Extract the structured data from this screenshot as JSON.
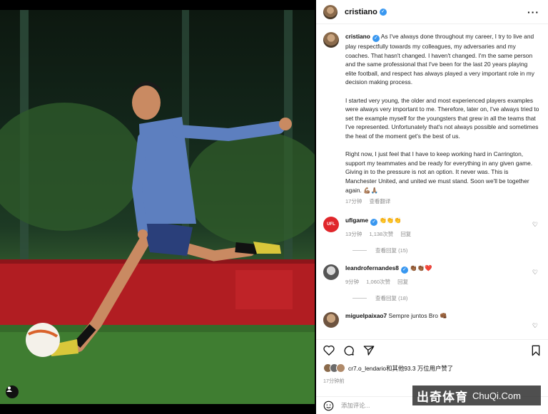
{
  "post": {
    "username": "cristiano",
    "caption": {
      "username": "cristiano",
      "p1": "As I've always done throughout my career, I try to live and play respectfully towards my colleagues, my adversaries and my coaches. That hasn't changed. I haven't changed. I'm the same person and the same professional that I've been for the last 20 years playing elite football, and respect has always played a very important role in my decision making process.",
      "p2": "I started very young, the older and most experienced players examples were always very important to me. Therefore, later on, I've always tried to set the example myself for the youngsters that grew in all the teams that I've represented. Unfortunately that's not always possible and sometimes the heat of the moment get's the best of us.",
      "p3": "Right now, I just feel that I have to keep working hard in Carrington, support my teammates and be ready for everything in any given game. Giving in to the pressure is not an option. It never was. This is Manchester United, and united we must stand. Soon we'll be together again. 💪🏽🙏🏽",
      "time": "17分钟",
      "translate": "查看翻译"
    },
    "comments": [
      {
        "username": "uflgame",
        "text": "👏👏👏",
        "time": "13分钟",
        "likes": "1,138次赞",
        "reply": "回复",
        "replies": "查看回复 (15)",
        "avatar_color": "#e0262b"
      },
      {
        "username": "leandrofernandes8",
        "text": "👏🏾👏🏾❤️",
        "time": "9分钟",
        "likes": "1,060次赞",
        "reply": "回复",
        "replies": "查看回复 (18)",
        "avatar_color": "#6b6b6b"
      },
      {
        "username": "miguelpaixao7",
        "text": "Sempre juntos Bro 👊🏾",
        "avatar_color": "#9b7d62"
      }
    ],
    "likes_text": "cr7.o_lendario和其他93.3 万位用户赞了",
    "posted_time": "17分钟前",
    "add_comment_placeholder": "添加评论..."
  },
  "icons": [
    "more-icon",
    "heart-icon",
    "comment-icon",
    "share-icon",
    "save-icon",
    "emoji-icon",
    "user-tag-icon",
    "verified-icon"
  ],
  "colors": {
    "verified": "#3897f0",
    "ufl_red": "#e0262b",
    "text_secondary": "#8e8e8e"
  },
  "watermark": {
    "cn": "出奇体育",
    "en": "ChuQi.Com"
  }
}
